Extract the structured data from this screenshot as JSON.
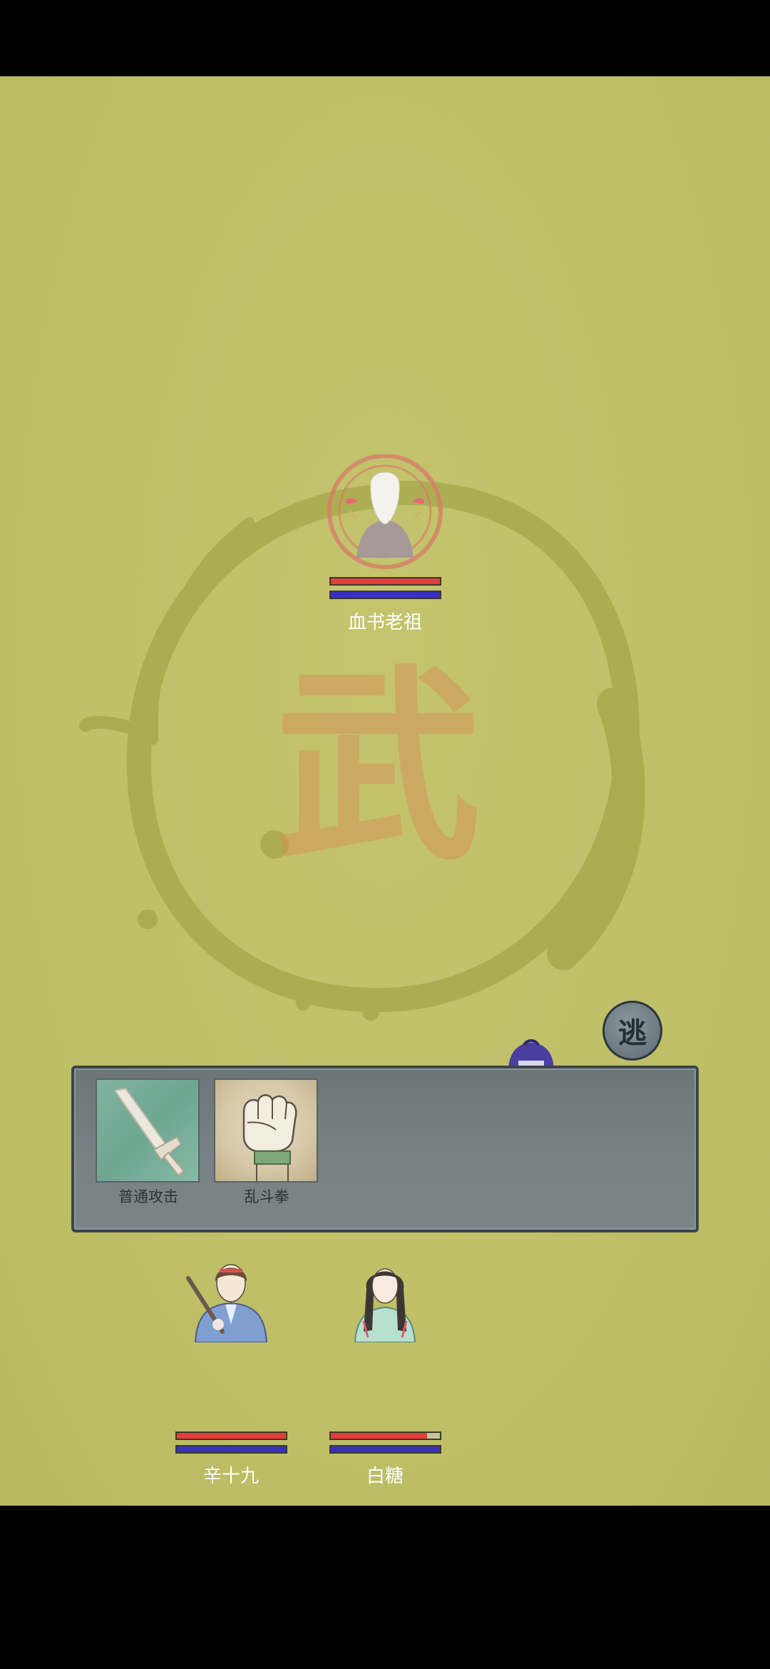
{
  "enemy": {
    "name": "血书老祖",
    "hp": 1.0,
    "mp": 1.0
  },
  "flee_button": {
    "label": "逃"
  },
  "skills": [
    {
      "label": "普通攻击",
      "icon": "sword-icon"
    },
    {
      "label": "乱斗拳",
      "icon": "fist-icon"
    }
  ],
  "party": [
    {
      "name": "辛十九",
      "hp": 1.0,
      "mp": 1.0
    },
    {
      "name": "白糖",
      "hp": 0.88,
      "mp": 1.0
    }
  ],
  "emblem": {
    "glyph": "武"
  },
  "colors": {
    "background": "#bfc068",
    "hp_bar": "#e2403a",
    "mp_bar": "#3a2fc4",
    "panel": "#798287"
  }
}
